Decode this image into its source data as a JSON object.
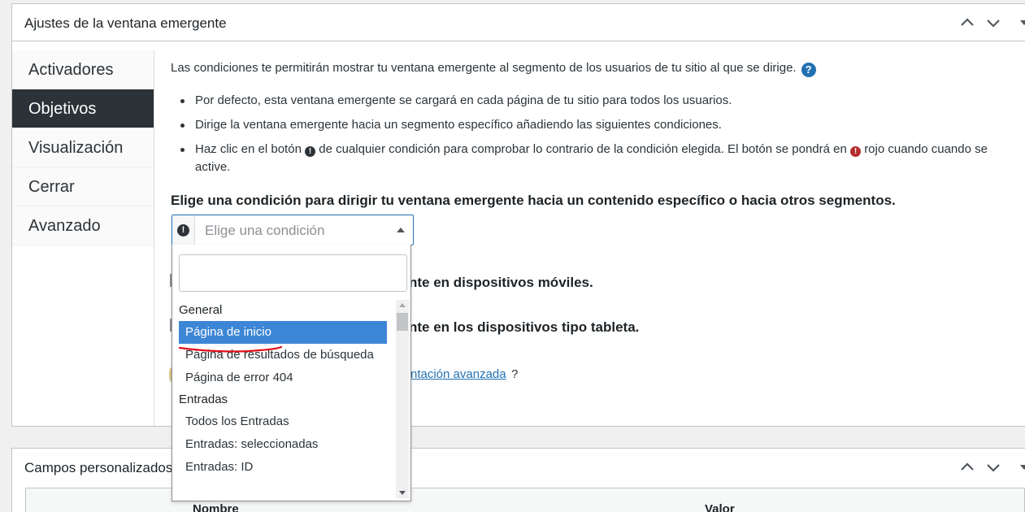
{
  "popup_settings": {
    "title": "Ajustes de la ventana emergente",
    "tabs": [
      {
        "label": "Activadores"
      },
      {
        "label": "Objetivos"
      },
      {
        "label": "Visualización"
      },
      {
        "label": "Cerrar"
      },
      {
        "label": "Avanzado"
      }
    ],
    "active_tab": "Objetivos",
    "intro": "Las condiciones te permitirán mostrar tu ventana emergente al segmento de los usuarios de tu sitio al que se dirige.",
    "help_icon": "?",
    "bullets": {
      "b1": "Por defecto, esta ventana emergente se cargará en cada página de tu sitio para todos los usuarios.",
      "b2": "Dirige la ventana emergente hacia un segmento específico añadiendo las siguientes condiciones.",
      "b3_part1": "Haz clic en el botón",
      "b3_part2": "de cualquier condición para comprobar lo contrario de la condición elegida. El botón se pondrá en",
      "b3_part3": "rojo cuando cuando se active."
    },
    "condition_heading": "Elige una condición para dirigir tu ventana emergente hacia un contenido específico o hacia otros segmentos.",
    "select": {
      "placeholder": "Elige una condición",
      "not_operand": "!"
    },
    "behind_text": {
      "mobile": "nte en dispositivos móviles.",
      "tablet": "nte en los dispositivos tipo tableta.",
      "link": "ntación avanzada",
      "link_suffix": "?"
    },
    "dropdown": {
      "search_value": "",
      "groups": {
        "general": "General",
        "entradas": "Entradas"
      },
      "options": {
        "home": "Página de inicio",
        "search_results": "Página de resultados de búsqueda",
        "error404": "Página de error 404",
        "all_posts": "Todos los Entradas",
        "selected_posts": "Entradas: seleccionadas",
        "post_id": "Entradas: ID"
      },
      "highlighted": "Página de inicio"
    }
  },
  "custom_fields": {
    "title": "Campos personalizados",
    "columns": {
      "name": "Nombre",
      "value": "Valor"
    }
  },
  "colors": {
    "active_tab_bg": "#2c3338",
    "highlight": "#3d86d6",
    "link": "#2271b1",
    "annotation": "#e0101a"
  }
}
